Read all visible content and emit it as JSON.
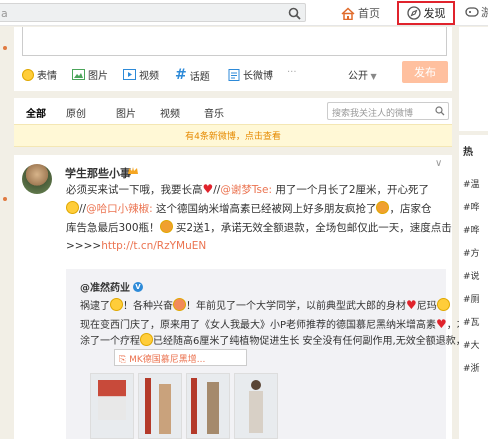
{
  "topbar": {
    "search_value": "a",
    "home_label": "首页",
    "discover_label": "发现",
    "game_label": "游"
  },
  "compose": {
    "tools": [
      "表情",
      "图片",
      "视频",
      "话题",
      "长微博"
    ],
    "visibility": "公开",
    "publish_label": "发布"
  },
  "filter": {
    "tabs": [
      "全部",
      "原创",
      "图片",
      "视频",
      "音乐"
    ],
    "search_placeholder": "搜索我关注人的微博"
  },
  "notice": "有4条新微博，点击查看",
  "post": {
    "author": "学生那些小事",
    "l1a": "必须买来试一下哦，我要长高",
    "l1b": "//",
    "l1c": "@谢梦Tse:",
    "l1d": " 用了一个月长了2厘米，开心死了",
    "l2a": "//",
    "l2b": "@哈口小辣椒:",
    "l2c": " 这个德国纳米增高素已经被网上好多朋友疯抢了",
    "l2d": "，店家仓",
    "l3a": "库告急最后300瓶！",
    "l3b": " 买2送1，承诺无效全额退款，全场包邮仅此一天，速度点击",
    "l4a": ">>>>",
    "l4b": "http://t.cn/RzYMuEN",
    "repost": {
      "author": "@准然药业",
      "r1a": "祸逮了",
      "r1b": "！各种兴奋",
      "r1c": "！年前见了一个大学同学，以前典型武大郎的身材",
      "r1d": "尼玛",
      "r2a": "现在变西门庆了，原来用了《女人我最大》小P老师推荐的德国慕尼黑纳米增高素",
      "r2b": "，才",
      "r3a": "涂了一个疗程",
      "r3b": "已经随高6厘米了纯植物促进生长 安全没有任何副作用,无效全额退款，分享：",
      "link_label": "MK德国慕尼黑增..."
    }
  },
  "sidebar": {
    "hot_title": "热",
    "hot_items": [
      "#温",
      "#哗",
      "#哗",
      "#方",
      "#说",
      "#厕",
      "#瓦",
      "#大",
      "#浙"
    ]
  },
  "colors": {
    "accent": "#eb7350",
    "discover_border": "#e0232c",
    "publish_bg": "#ffc09f",
    "notice_bg": "#fff8d6"
  }
}
